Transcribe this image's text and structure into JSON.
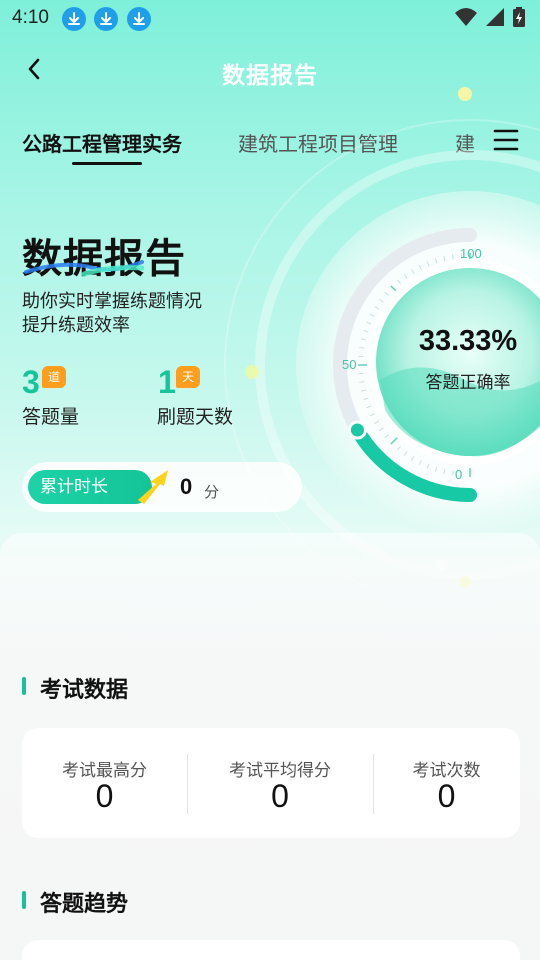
{
  "status_bar": {
    "time": "4:10",
    "icons": [
      "download-icon",
      "download-icon",
      "download-icon",
      "wifi-icon",
      "signal-icon",
      "battery-icon"
    ]
  },
  "nav": {
    "title": "数据报告",
    "back_icon": "back-chevron-icon",
    "menu_icon": "menu-icon"
  },
  "tabs": [
    {
      "label": "公路工程管理实务",
      "active": true
    },
    {
      "label": "建筑工程项目管理",
      "active": false
    },
    {
      "label": "建",
      "active": false
    }
  ],
  "hero": {
    "title": "数据报告",
    "desc_line1": "助你实时掌握练题情况",
    "desc_line2": "提升练题效率"
  },
  "stats": {
    "questions": {
      "value": "3",
      "badge": "道",
      "label": "答题量"
    },
    "days": {
      "value": "1",
      "badge": "天",
      "label": "刷题天数"
    }
  },
  "duration": {
    "tag": "累计时长",
    "value": "0",
    "unit": "分"
  },
  "gauge": {
    "percent_text": "33.33%",
    "percent_value": 33.33,
    "label": "答题正确率",
    "scale_max": "100",
    "scale_mid": "50",
    "scale_min": "0",
    "accent_color": "#17c9a4"
  },
  "exam_section": {
    "title": "考试数据",
    "items": [
      {
        "label": "考试最高分",
        "value": "0"
      },
      {
        "label": "考试平均得分",
        "value": "0"
      },
      {
        "label": "考试次数",
        "value": "0"
      }
    ]
  },
  "trend_section": {
    "title": "答题趋势"
  }
}
